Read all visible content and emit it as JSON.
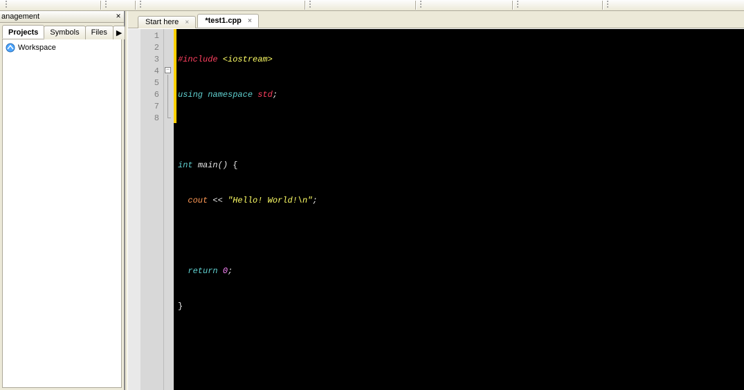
{
  "side_panel": {
    "title": "anagement",
    "tabs": [
      {
        "label": "Projects",
        "active": true
      },
      {
        "label": "Symbols",
        "active": false
      },
      {
        "label": "Files",
        "active": false
      }
    ],
    "overflow_glyph": "▶",
    "workspace_label": "Workspace"
  },
  "editor_tabs": [
    {
      "label": "Start here",
      "active": false
    },
    {
      "label": "*test1.cpp",
      "active": true
    }
  ],
  "editor": {
    "filename": "*test1.cpp",
    "line_numbers": [
      1,
      2,
      3,
      4,
      5,
      6,
      7,
      8
    ],
    "fold_minus": "−",
    "code": {
      "l1_include": "#include",
      "l1_header": "<iostream>",
      "l2_using": "using",
      "l2_namespace": "namespace",
      "l2_std": "std",
      "l4_int": "int",
      "l4_main": "main",
      "l4_parens": "()",
      "l4_brace_open": "{",
      "l5_cout": "cout",
      "l5_lshift": "<<",
      "l5_string": "\"Hello! World!\\n\"",
      "l7_return": "return",
      "l7_zero": "0",
      "l8_brace_close": "}",
      "semi": ";"
    }
  },
  "glyphs": {
    "close_x": "×",
    "tab_close_x": "×"
  }
}
